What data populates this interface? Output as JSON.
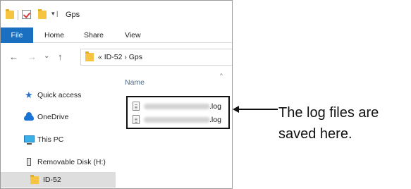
{
  "window": {
    "title": "Gps",
    "qat_dropdown": "▾ |"
  },
  "ribbon": {
    "tabs": [
      "File",
      "Home",
      "Share",
      "View"
    ]
  },
  "navbar": {
    "back": "←",
    "forward": "→",
    "recent": "⌄",
    "up": "↑",
    "address_text": "« ID-52 › Gps"
  },
  "navpane": {
    "items": [
      {
        "label": "Quick access",
        "icon": "star-icon"
      },
      {
        "label": "OneDrive",
        "icon": "cloud-icon"
      },
      {
        "label": "This PC",
        "icon": "computer-icon"
      },
      {
        "label": "Removable Disk (H:)",
        "icon": "drive-icon"
      },
      {
        "label": "ID-52",
        "icon": "folder-icon",
        "selected": true
      }
    ]
  },
  "content": {
    "column_name": "Name",
    "sort_glyph": "^",
    "files": [
      {
        "ext": ".log"
      },
      {
        "ext": ".log"
      }
    ]
  },
  "annotation": {
    "line1": "The log files are",
    "line2": "saved here."
  },
  "colors": {
    "file_tab": "#1a6fc0",
    "folder": "#f5c542",
    "selected_row": "#dedede"
  }
}
